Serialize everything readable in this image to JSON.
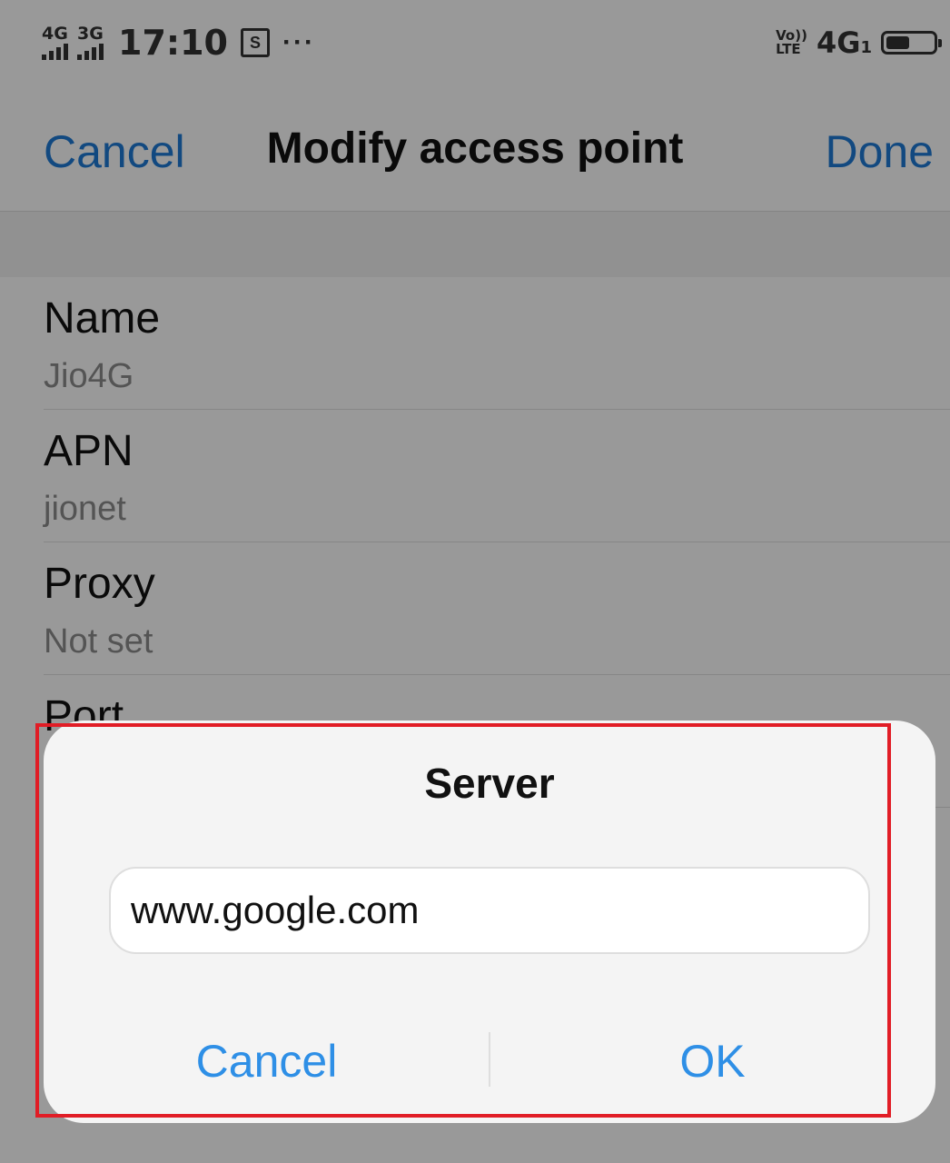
{
  "status_bar": {
    "signal_1": "4G",
    "signal_2": "3G",
    "time": "17:10",
    "notification": "S",
    "more": "···",
    "volte_top": "Vo))",
    "volte_bottom": "LTE",
    "network": "4G",
    "sim": "1",
    "battery_level": 0.56
  },
  "header": {
    "cancel_label": "Cancel",
    "title": "Modify access point",
    "done_label": "Done"
  },
  "settings": [
    {
      "label": "Name",
      "value": "Jio4G"
    },
    {
      "label": "APN",
      "value": "jionet"
    },
    {
      "label": "Proxy",
      "value": "Not set"
    },
    {
      "label": "Port",
      "value": ""
    }
  ],
  "dialog": {
    "title": "Server",
    "input_value": "www.google.com",
    "cancel_label": "Cancel",
    "ok_label": "OK"
  },
  "colors": {
    "accent": "#1f7bd6",
    "dialog_button": "#2e8fe6",
    "highlight": "#e11d26"
  }
}
